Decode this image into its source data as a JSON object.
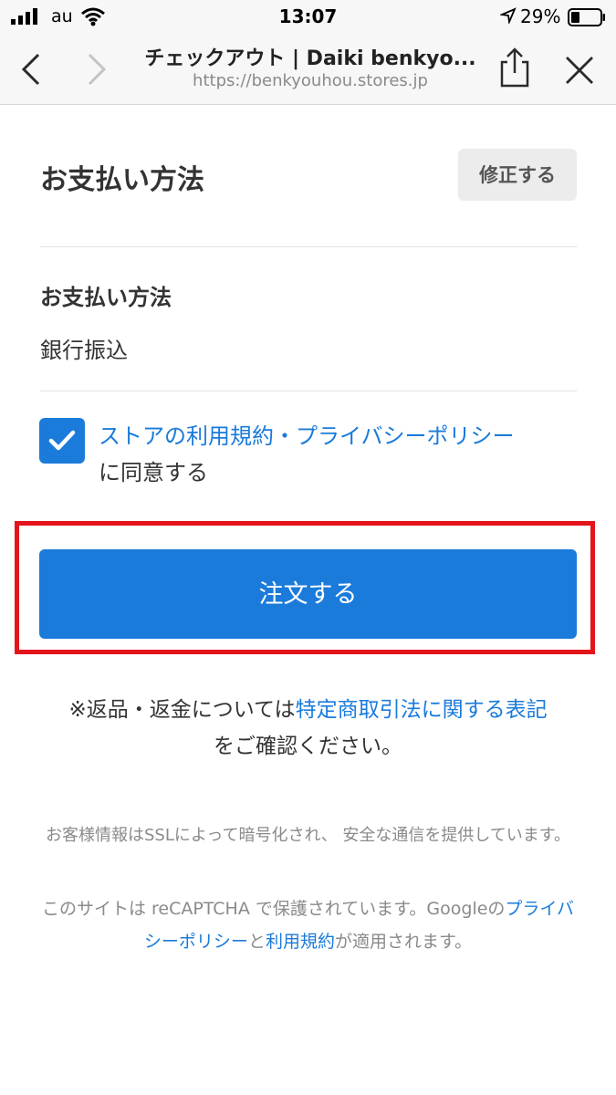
{
  "status_bar": {
    "carrier": "au",
    "time": "13:07",
    "battery_percent": "29%"
  },
  "browser": {
    "title": "チェックアウト | Daiki benkyo...",
    "url": "https://benkyouhou.stores.jp"
  },
  "payment": {
    "section_title": "お支払い方法",
    "edit_label": "修正する",
    "method_label": "お支払い方法",
    "method_value": "銀行振込"
  },
  "agreement": {
    "checked": true,
    "terms_link": "ストアの利用規約",
    "separator": "・",
    "privacy_link": "プライバシーポリシー",
    "suffix": "に同意する"
  },
  "order_button_label": "注文する",
  "notice": {
    "prefix": "※返品・返金については",
    "link": "特定商取引法に関する表記",
    "suffix": "をご確認ください。"
  },
  "footer": {
    "ssl_text": "お客様情報はSSLによって暗号化され、 安全な通信を提供しています。",
    "recaptcha_prefix": "このサイトは reCAPTCHA で保護されています。Googleの",
    "privacy_link": "プライバシーポリシー",
    "and": "と",
    "terms_link": "利用規約",
    "recaptcha_suffix": "が適用されます。"
  },
  "colors": {
    "accent": "#1a7bdb",
    "highlight": "#e4141b"
  },
  "icons": {
    "back": "chevron-left-icon",
    "forward": "chevron-right-icon",
    "share": "share-icon",
    "close": "close-icon",
    "checkbox": "checkmark-icon"
  }
}
